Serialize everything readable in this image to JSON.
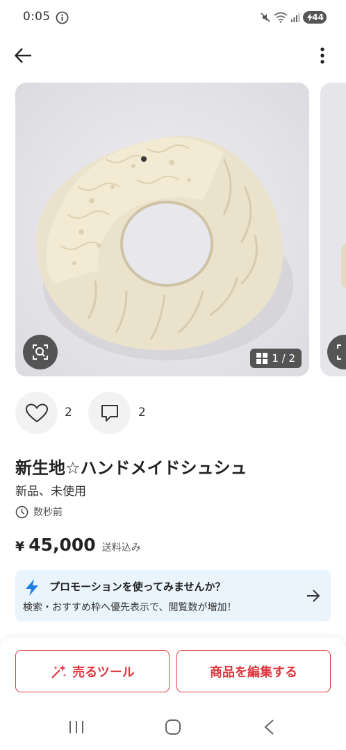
{
  "status_bar": {
    "time": "0:05",
    "battery": "44"
  },
  "carousel": {
    "page_indicator": "1 / 2"
  },
  "social": {
    "like_count": "2",
    "comment_count": "2"
  },
  "item": {
    "title": "新生地☆ハンドメイドシュシュ",
    "condition": "新品、未使用",
    "posted_time": "数秒前",
    "price_currency": "¥",
    "price": "45,000",
    "price_note": "送料込み"
  },
  "promotion": {
    "title": "プロモーションを使ってみませんか？",
    "description": "検索・おすすめ枠へ優先表示で、閲覧数が増加！"
  },
  "actions": {
    "sell_tools_label": "売るツール",
    "edit_item_label": "商品を編集する"
  },
  "colors": {
    "accent": "#e0363f",
    "promo_bg": "#eaf4fd",
    "promo_icon": "#1e7fe0"
  }
}
